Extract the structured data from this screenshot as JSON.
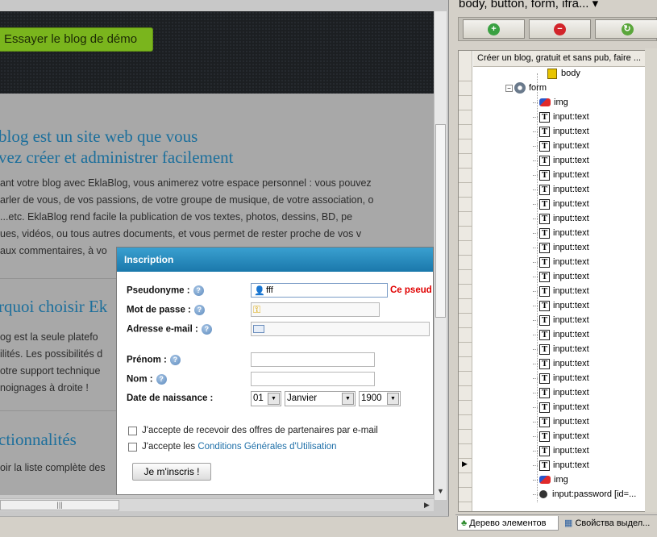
{
  "browser": {
    "demo_button": "Essayer le blog de démo",
    "heading1_line1": "blog est un site web que vous",
    "heading1_line2": "vez créer et administrer facilement",
    "para1": [
      "ant votre blog avec EklaBlog, vous animerez votre espace personnel : vous pouvez",
      "arler de vous, de vos passions, de votre groupe de musique, de votre association, o",
      "...etc. EklaBlog rend facile la publication de vos textes, photos, dessins, BD, pe",
      "ues, vidéos, ou tous autres documents, et vous permet de rester proche de vos v",
      "aux commentaires, à vo"
    ],
    "heading2": "rquoi choisir Ek",
    "para2": [
      "og est la seule platefo",
      "ilités. Les possibilités d",
      "otre support technique",
      "noignages à droite !"
    ],
    "heading3": "ctionnalités",
    "para3": "oir la liste complète des",
    "hscroll_grip": "|||"
  },
  "modal": {
    "title": "Inscription",
    "fields": {
      "pseudonyme_label": "Pseudonyme :",
      "pseudonyme_value": "fff",
      "pseudonyme_error": "Ce pseud",
      "password_label": "Mot de passe :",
      "email_label": "Adresse e-mail :",
      "firstname_label": "Prénom :",
      "name_label": "Nom :",
      "birth_label": "Date de naissance :",
      "day": "01",
      "month": "Janvier",
      "year": "1900"
    },
    "help_glyph": "?",
    "checkbox1": "J'accepte de recevoir des offres de partenaires par e-mail",
    "checkbox2_prefix": "J'accepte les ",
    "checkbox2_link": "Conditions Générales d'Utilisation",
    "submit": "Je m'inscris !"
  },
  "rpane": {
    "title": "body, button, form, ifra... ▾",
    "tree_header": "Créer un blog, gratuit et sans pub, faire ...",
    "nodes": {
      "body": "body",
      "form": "form",
      "img1": "img",
      "input_text": "input:text",
      "img2": "img",
      "last": "input:password [id=..."
    },
    "tabs": {
      "tree": "Дерево элементов",
      "props": "Свойства выдел..."
    }
  },
  "colors": {
    "accent_green": "#7ab51d",
    "heading_blue": "#1c6f9c",
    "modal_header": "#1a78ab",
    "error_red": "#e00000"
  }
}
